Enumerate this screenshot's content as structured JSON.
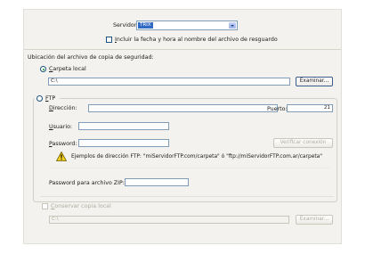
{
  "server": {
    "label": "Servidor:",
    "value": "TRIX"
  },
  "include_date": {
    "label": "Incluir la fecha y hora al nombre del archivo de resguardo",
    "checked": false
  },
  "location": {
    "heading": "Ubicación del archivo de copia de seguridad:",
    "local_folder": {
      "label": "Carpeta local",
      "selected": true,
      "path": "C:\\",
      "browse_label": "Examinar..."
    },
    "ftp": {
      "label": "FTP",
      "selected": false,
      "address_label": "Dirección:",
      "address_value": "",
      "port_label": "Puerto:",
      "port_value": "21",
      "user_label": "Usuario:",
      "user_value": "",
      "password_label": "Password:",
      "password_value": "",
      "verify_label": "Verificar conexión",
      "example_text": "Ejemplos de dirección FTP: \"miServidorFTP.com/carpeta\" ó \"ftp://miServidorFTP.com.ar/carpeta\""
    }
  },
  "zip_password": {
    "label": "Password para archivo ZIP:",
    "value": ""
  },
  "keep_local_copy": {
    "label": "Conservar copia local",
    "checked": false,
    "path": "C:\\",
    "browse_label": "Examinar..."
  }
}
